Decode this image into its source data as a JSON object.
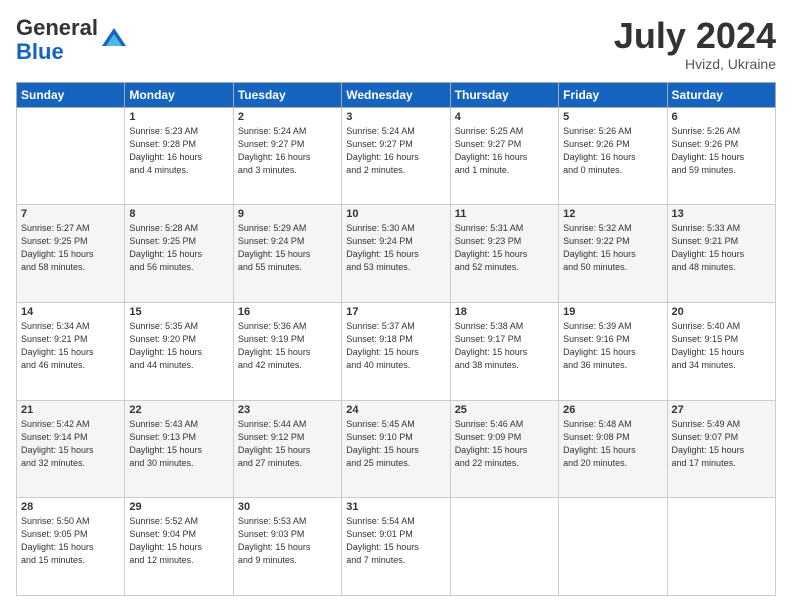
{
  "logo": {
    "general": "General",
    "blue": "Blue"
  },
  "header": {
    "month": "July 2024",
    "location": "Hvizd, Ukraine"
  },
  "days": [
    "Sunday",
    "Monday",
    "Tuesday",
    "Wednesday",
    "Thursday",
    "Friday",
    "Saturday"
  ],
  "weeks": [
    [
      {
        "day": "",
        "content": ""
      },
      {
        "day": "1",
        "content": "Sunrise: 5:23 AM\nSunset: 9:28 PM\nDaylight: 16 hours\nand 4 minutes."
      },
      {
        "day": "2",
        "content": "Sunrise: 5:24 AM\nSunset: 9:27 PM\nDaylight: 16 hours\nand 3 minutes."
      },
      {
        "day": "3",
        "content": "Sunrise: 5:24 AM\nSunset: 9:27 PM\nDaylight: 16 hours\nand 2 minutes."
      },
      {
        "day": "4",
        "content": "Sunrise: 5:25 AM\nSunset: 9:27 PM\nDaylight: 16 hours\nand 1 minute."
      },
      {
        "day": "5",
        "content": "Sunrise: 5:26 AM\nSunset: 9:26 PM\nDaylight: 16 hours\nand 0 minutes."
      },
      {
        "day": "6",
        "content": "Sunrise: 5:26 AM\nSunset: 9:26 PM\nDaylight: 15 hours\nand 59 minutes."
      }
    ],
    [
      {
        "day": "7",
        "content": "Sunrise: 5:27 AM\nSunset: 9:25 PM\nDaylight: 15 hours\nand 58 minutes."
      },
      {
        "day": "8",
        "content": "Sunrise: 5:28 AM\nSunset: 9:25 PM\nDaylight: 15 hours\nand 56 minutes."
      },
      {
        "day": "9",
        "content": "Sunrise: 5:29 AM\nSunset: 9:24 PM\nDaylight: 15 hours\nand 55 minutes."
      },
      {
        "day": "10",
        "content": "Sunrise: 5:30 AM\nSunset: 9:24 PM\nDaylight: 15 hours\nand 53 minutes."
      },
      {
        "day": "11",
        "content": "Sunrise: 5:31 AM\nSunset: 9:23 PM\nDaylight: 15 hours\nand 52 minutes."
      },
      {
        "day": "12",
        "content": "Sunrise: 5:32 AM\nSunset: 9:22 PM\nDaylight: 15 hours\nand 50 minutes."
      },
      {
        "day": "13",
        "content": "Sunrise: 5:33 AM\nSunset: 9:21 PM\nDaylight: 15 hours\nand 48 minutes."
      }
    ],
    [
      {
        "day": "14",
        "content": "Sunrise: 5:34 AM\nSunset: 9:21 PM\nDaylight: 15 hours\nand 46 minutes."
      },
      {
        "day": "15",
        "content": "Sunrise: 5:35 AM\nSunset: 9:20 PM\nDaylight: 15 hours\nand 44 minutes."
      },
      {
        "day": "16",
        "content": "Sunrise: 5:36 AM\nSunset: 9:19 PM\nDaylight: 15 hours\nand 42 minutes."
      },
      {
        "day": "17",
        "content": "Sunrise: 5:37 AM\nSunset: 9:18 PM\nDaylight: 15 hours\nand 40 minutes."
      },
      {
        "day": "18",
        "content": "Sunrise: 5:38 AM\nSunset: 9:17 PM\nDaylight: 15 hours\nand 38 minutes."
      },
      {
        "day": "19",
        "content": "Sunrise: 5:39 AM\nSunset: 9:16 PM\nDaylight: 15 hours\nand 36 minutes."
      },
      {
        "day": "20",
        "content": "Sunrise: 5:40 AM\nSunset: 9:15 PM\nDaylight: 15 hours\nand 34 minutes."
      }
    ],
    [
      {
        "day": "21",
        "content": "Sunrise: 5:42 AM\nSunset: 9:14 PM\nDaylight: 15 hours\nand 32 minutes."
      },
      {
        "day": "22",
        "content": "Sunrise: 5:43 AM\nSunset: 9:13 PM\nDaylight: 15 hours\nand 30 minutes."
      },
      {
        "day": "23",
        "content": "Sunrise: 5:44 AM\nSunset: 9:12 PM\nDaylight: 15 hours\nand 27 minutes."
      },
      {
        "day": "24",
        "content": "Sunrise: 5:45 AM\nSunset: 9:10 PM\nDaylight: 15 hours\nand 25 minutes."
      },
      {
        "day": "25",
        "content": "Sunrise: 5:46 AM\nSunset: 9:09 PM\nDaylight: 15 hours\nand 22 minutes."
      },
      {
        "day": "26",
        "content": "Sunrise: 5:48 AM\nSunset: 9:08 PM\nDaylight: 15 hours\nand 20 minutes."
      },
      {
        "day": "27",
        "content": "Sunrise: 5:49 AM\nSunset: 9:07 PM\nDaylight: 15 hours\nand 17 minutes."
      }
    ],
    [
      {
        "day": "28",
        "content": "Sunrise: 5:50 AM\nSunset: 9:05 PM\nDaylight: 15 hours\nand 15 minutes."
      },
      {
        "day": "29",
        "content": "Sunrise: 5:52 AM\nSunset: 9:04 PM\nDaylight: 15 hours\nand 12 minutes."
      },
      {
        "day": "30",
        "content": "Sunrise: 5:53 AM\nSunset: 9:03 PM\nDaylight: 15 hours\nand 9 minutes."
      },
      {
        "day": "31",
        "content": "Sunrise: 5:54 AM\nSunset: 9:01 PM\nDaylight: 15 hours\nand 7 minutes."
      },
      {
        "day": "",
        "content": ""
      },
      {
        "day": "",
        "content": ""
      },
      {
        "day": "",
        "content": ""
      }
    ]
  ]
}
